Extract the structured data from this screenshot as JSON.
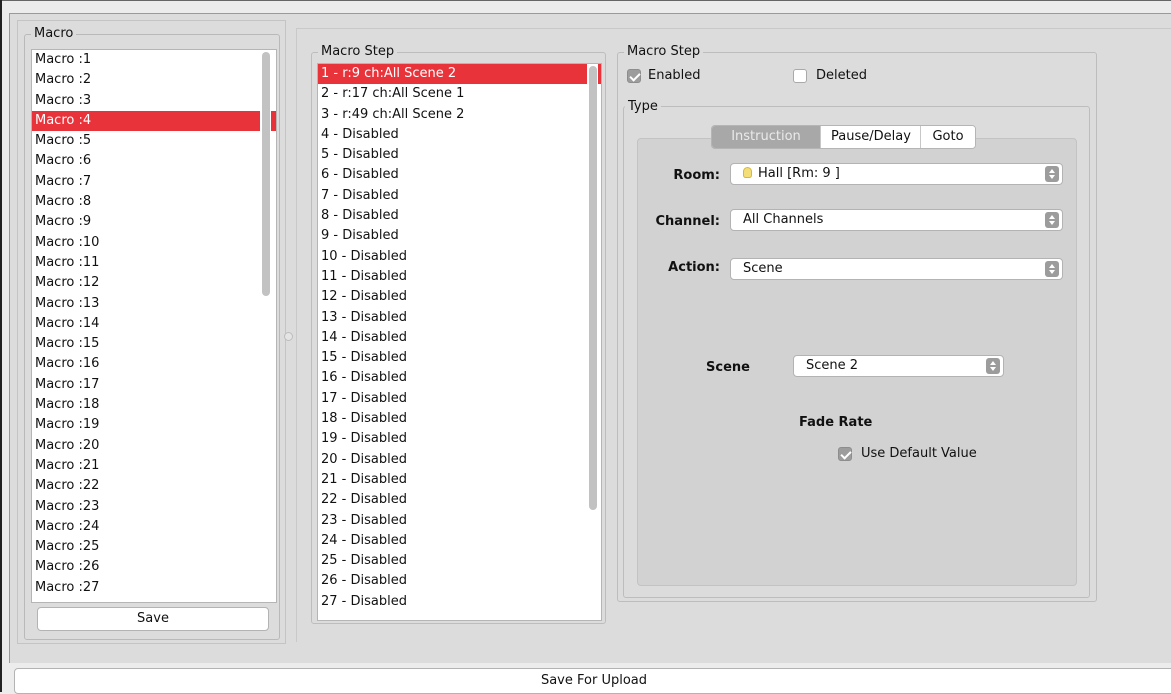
{
  "macro_panel": {
    "legend": "Macro",
    "items": [
      "Macro :1",
      "Macro :2",
      "Macro :3",
      "Macro :4",
      "Macro :5",
      "Macro :6",
      "Macro :7",
      "Macro :8",
      "Macro :9",
      "Macro :10",
      "Macro :11",
      "Macro :12",
      "Macro :13",
      "Macro :14",
      "Macro :15",
      "Macro :16",
      "Macro :17",
      "Macro :18",
      "Macro :19",
      "Macro :20",
      "Macro :21",
      "Macro :22",
      "Macro :23",
      "Macro :24",
      "Macro :25",
      "Macro :26",
      "Macro :27"
    ],
    "selected_index": 3,
    "save_label": "Save"
  },
  "steps_panel": {
    "legend": "Macro Step",
    "items": [
      "1 - r:9 ch:All Scene 2",
      "2 - r:17 ch:All Scene 1",
      "3 - r:49 ch:All Scene 2",
      "4 - Disabled",
      "5 - Disabled",
      "6 - Disabled",
      "7 - Disabled",
      "8 - Disabled",
      "9 - Disabled",
      "10 - Disabled",
      "11 - Disabled",
      "12 - Disabled",
      "13 - Disabled",
      "14 - Disabled",
      "15 - Disabled",
      "16 - Disabled",
      "17 - Disabled",
      "18 - Disabled",
      "19 - Disabled",
      "20 - Disabled",
      "21 - Disabled",
      "22 - Disabled",
      "23 - Disabled",
      "24 - Disabled",
      "25 - Disabled",
      "26 - Disabled",
      "27 - Disabled"
    ],
    "selected_index": 0
  },
  "step_detail": {
    "legend": "Macro Step",
    "enabled_label": "Enabled",
    "enabled_checked": true,
    "deleted_label": "Deleted",
    "deleted_checked": false,
    "type_legend": "Type",
    "tabs": [
      "Instruction",
      "Pause/Delay",
      "Goto"
    ],
    "active_tab_index": 0,
    "room_label": "Room:",
    "room_value": "Hall [Rm: 9 ]",
    "room_icon": "lightbulb-icon",
    "channel_label": "Channel:",
    "channel_value": "All Channels",
    "action_label": "Action:",
    "action_value": "Scene",
    "scene_label": "Scene",
    "scene_value": "Scene 2",
    "fade_rate_label": "Fade Rate",
    "use_default_label": "Use Default Value",
    "use_default_checked": true
  },
  "footer": {
    "save_for_upload_label": "Save For Upload"
  },
  "colors": {
    "selection": "#e8333b",
    "window_bg": "#dcdcdc"
  }
}
